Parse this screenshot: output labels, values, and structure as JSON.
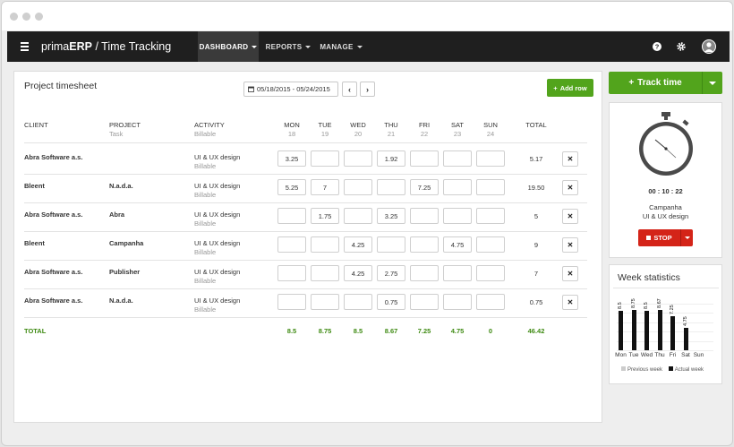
{
  "app": {
    "brand_a": "prima",
    "brand_b": "ERP",
    "brand_c": " / Time Tracking"
  },
  "nav": [
    {
      "label": "DASHBOARD",
      "active": true
    },
    {
      "label": "REPORTS",
      "active": false
    },
    {
      "label": "MANAGE",
      "active": false
    }
  ],
  "timesheet": {
    "title": "Project timesheet",
    "date_range": "05/18/2015 - 05/24/2015",
    "add_row_label": "Add row",
    "headers": {
      "client": "CLIENT",
      "project": "PROJECT",
      "project_sub": "Task",
      "activity": "ACTIVITY",
      "activity_sub": "Billable",
      "total": "TOTAL"
    },
    "days": [
      {
        "name": "MON",
        "date": "18"
      },
      {
        "name": "TUE",
        "date": "19"
      },
      {
        "name": "WED",
        "date": "20"
      },
      {
        "name": "THU",
        "date": "21"
      },
      {
        "name": "FRI",
        "date": "22"
      },
      {
        "name": "SAT",
        "date": "23"
      },
      {
        "name": "SUN",
        "date": "24"
      }
    ],
    "rows": [
      {
        "client": "Abra Software a.s.",
        "project": "",
        "activity": "UI & UX design",
        "billable": "Billable",
        "values": [
          "3.25",
          "",
          "",
          "1.92",
          "",
          "",
          ""
        ],
        "total": "5.17"
      },
      {
        "client": "Bleent",
        "project": "N.a.d.a.",
        "activity": "UI & UX design",
        "billable": "Billable",
        "values": [
          "5.25",
          "7",
          "",
          "",
          "7.25",
          "",
          ""
        ],
        "total": "19.50"
      },
      {
        "client": "Abra Software a.s.",
        "project": "Abra",
        "activity": "UI & UX design",
        "billable": "Billable",
        "values": [
          "",
          "1.75",
          "",
          "3.25",
          "",
          "",
          ""
        ],
        "total": "5"
      },
      {
        "client": "Bleent",
        "project": "Campanha",
        "activity": "UI & UX design",
        "billable": "Billable",
        "values": [
          "",
          "",
          "4.25",
          "",
          "",
          "4.75",
          ""
        ],
        "total": "9"
      },
      {
        "client": "Abra Software a.s.",
        "project": "Publisher",
        "activity": "UI & UX design",
        "billable": "Billable",
        "values": [
          "",
          "",
          "4.25",
          "2.75",
          "",
          "",
          ""
        ],
        "total": "7"
      },
      {
        "client": "Abra Software a.s.",
        "project": "N.a.d.a.",
        "activity": "UI & UX design",
        "billable": "Billable",
        "values": [
          "",
          "",
          "",
          "0.75",
          "",
          "",
          ""
        ],
        "total": "0.75"
      }
    ],
    "totals": {
      "label": "TOTAL",
      "values": [
        "8.5",
        "8.75",
        "8.5",
        "8.67",
        "7.25",
        "4.75",
        "0"
      ],
      "grand": "46.42"
    }
  },
  "tracker": {
    "track_label": "Track time",
    "time": "00 : 10 : 22",
    "project": "Campanha",
    "activity": "UI & UX design",
    "stop_label": "STOP"
  },
  "week_stats": {
    "title": "Week statistics",
    "legend_previous": "Previous week",
    "legend_actual": "Actual week"
  },
  "chart_data": {
    "type": "bar",
    "title": "Week statistics",
    "categories": [
      "Mon",
      "Tue",
      "Wed",
      "Thu",
      "Fri",
      "Sat",
      "Sun"
    ],
    "series": [
      {
        "name": "Actual week",
        "values": [
          8.5,
          8.75,
          8.5,
          8.67,
          7.25,
          4.75,
          0
        ]
      }
    ],
    "data_labels": [
      "8.5",
      "8.75",
      "8.5",
      "8.67",
      "7.25",
      "4.75",
      "0"
    ],
    "legend": [
      "Previous week",
      "Actual week"
    ],
    "legend_placement": "bottom",
    "ylim": [
      0,
      10
    ],
    "colors": {
      "actual": "#111111",
      "previous": "#cccccc"
    }
  },
  "colors": {
    "green": "#52a41c",
    "red": "#d42418",
    "topbar": "#1f1f1f",
    "total_green": "#3e8a12"
  }
}
